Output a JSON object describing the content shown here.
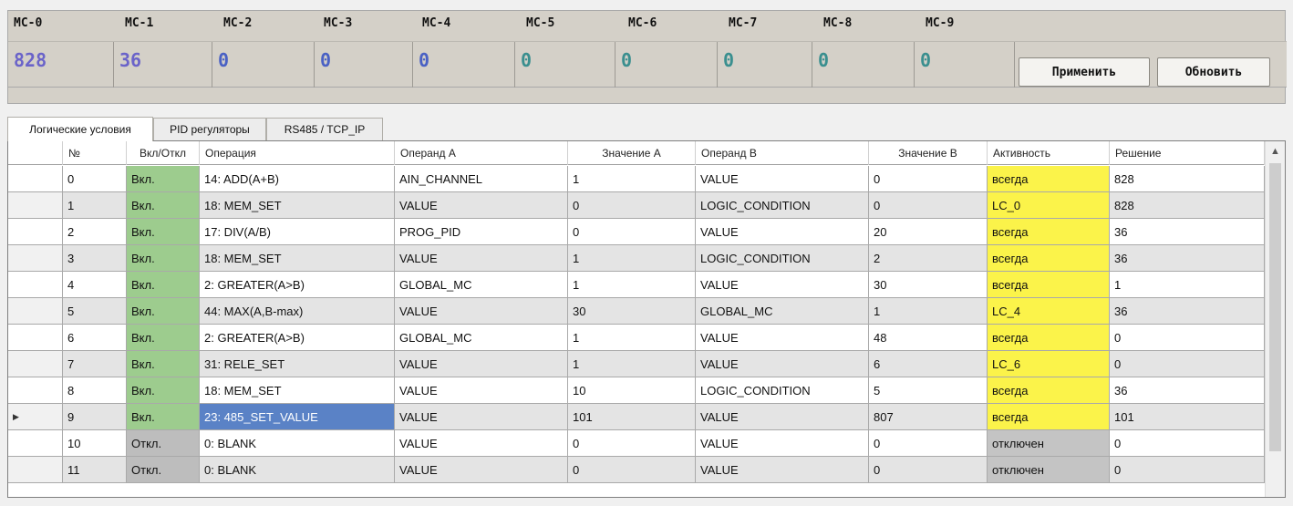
{
  "mc": {
    "labels": [
      "MC-0",
      "MC-1",
      "MC-2",
      "MC-3",
      "MC-4",
      "MC-5",
      "MC-6",
      "MC-7",
      "MC-8",
      "MC-9"
    ],
    "values": [
      "828",
      "36",
      "0",
      "0",
      "0",
      "0",
      "0",
      "0",
      "0",
      "0"
    ],
    "colors": {
      "mc0": "#6a63c9",
      "mc1": "#6a63c9",
      "mc2": "#4a61c4",
      "mc3": "#4a61c4",
      "mc4": "#4a61c4",
      "mc5": "#3a8f8f",
      "mc6": "#3a8f8f",
      "mc7": "#3a8f8f",
      "mc8": "#3a8f8f",
      "mc9": "#3a8f8f"
    }
  },
  "buttons": {
    "apply": "Применить",
    "refresh": "Обновить"
  },
  "tabs": [
    "Логические условия",
    "PID регуляторы",
    "RS485 / TCP_IP"
  ],
  "table": {
    "headers": [
      "№",
      "Вкл/Откл",
      "Операция",
      "Операнд А",
      "Значение А",
      "Операнд В",
      "Значение В",
      "Активность",
      "Решение"
    ],
    "rows": [
      {
        "n": "0",
        "state": "Вкл.",
        "op": "14: ADD(A+B)",
        "opA": "AIN_CHANNEL",
        "valA": "1",
        "opB": "VALUE",
        "valB": "0",
        "act": "всегда",
        "res": "828"
      },
      {
        "n": "1",
        "state": "Вкл.",
        "op": "18: MEM_SET",
        "opA": "VALUE",
        "valA": "0",
        "opB": "LOGIC_CONDITION",
        "valB": "0",
        "act": "LC_0",
        "res": "828"
      },
      {
        "n": "2",
        "state": "Вкл.",
        "op": "17: DIV(A/B)",
        "opA": "PROG_PID",
        "valA": "0",
        "opB": "VALUE",
        "valB": "20",
        "act": "всегда",
        "res": "36"
      },
      {
        "n": "3",
        "state": "Вкл.",
        "op": "18: MEM_SET",
        "opA": "VALUE",
        "valA": "1",
        "opB": "LOGIC_CONDITION",
        "valB": "2",
        "act": "всегда",
        "res": "36"
      },
      {
        "n": "4",
        "state": "Вкл.",
        "op": "2: GREATER(A>B)",
        "opA": "GLOBAL_MC",
        "valA": "1",
        "opB": "VALUE",
        "valB": "30",
        "act": "всегда",
        "res": "1"
      },
      {
        "n": "5",
        "state": "Вкл.",
        "op": "44: MAX(A,B-max)",
        "opA": "VALUE",
        "valA": "30",
        "opB": "GLOBAL_MC",
        "valB": "1",
        "act": "LC_4",
        "res": "36"
      },
      {
        "n": "6",
        "state": "Вкл.",
        "op": "2: GREATER(A>B)",
        "opA": "GLOBAL_MC",
        "valA": "1",
        "opB": "VALUE",
        "valB": "48",
        "act": "всегда",
        "res": "0"
      },
      {
        "n": "7",
        "state": "Вкл.",
        "op": "31: RELE_SET",
        "opA": "VALUE",
        "valA": "1",
        "opB": "VALUE",
        "valB": "6",
        "act": "LC_6",
        "res": "0"
      },
      {
        "n": "8",
        "state": "Вкл.",
        "op": "18: MEM_SET",
        "opA": "VALUE",
        "valA": "10",
        "opB": "LOGIC_CONDITION",
        "valB": "5",
        "act": "всегда",
        "res": "36"
      },
      {
        "n": "9",
        "state": "Вкл.",
        "op": "23: 485_SET_VALUE",
        "opA": "VALUE",
        "valA": "101",
        "opB": "VALUE",
        "valB": "807",
        "act": "всегда",
        "res": "101"
      },
      {
        "n": "10",
        "state": "Откл.",
        "op": "0: BLANK",
        "opA": "VALUE",
        "valA": "0",
        "opB": "VALUE",
        "valB": "0",
        "act": "отключен",
        "res": "0"
      },
      {
        "n": "11",
        "state": "Откл.",
        "op": "0: BLANK",
        "opA": "VALUE",
        "valA": "0",
        "opB": "VALUE",
        "valB": "0",
        "act": "отключен",
        "res": "0"
      }
    ]
  },
  "selection": {
    "row": 9,
    "column": "op"
  },
  "icons": {
    "current_row": "triangle-right-icon",
    "scroll_up": "chevron-up-icon"
  }
}
